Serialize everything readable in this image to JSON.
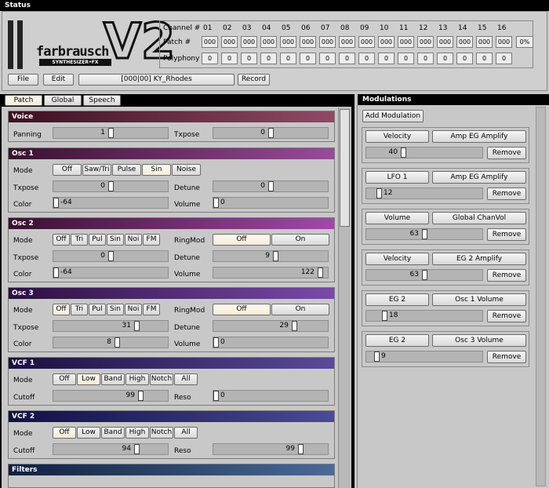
{
  "status": {
    "title": "Status",
    "file": "File",
    "edit": "Edit",
    "patch_name": "[000|00] KY_Rhodes",
    "record": "Record",
    "logo_text": "farbrausch",
    "logo_sub": "SYNTHESIZER•FX",
    "logo_big": "V2",
    "channel_label": "Channel #",
    "patch_label": "Patch #",
    "poly_label": "Polyphony",
    "channels": [
      "01",
      "02",
      "03",
      "04",
      "05",
      "06",
      "07",
      "08",
      "09",
      "10",
      "11",
      "12",
      "13",
      "14",
      "15",
      "16"
    ],
    "patches": [
      "000",
      "000",
      "000",
      "000",
      "000",
      "000",
      "000",
      "000",
      "000",
      "000",
      "000",
      "000",
      "000",
      "000",
      "000",
      "000"
    ],
    "polyphony": [
      "0",
      "0",
      "0",
      "0",
      "0",
      "0",
      "0",
      "0",
      "0",
      "0",
      "0",
      "0",
      "0",
      "0",
      "0",
      "0"
    ],
    "cpu": "0%"
  },
  "tabs": [
    "Patch",
    "Global",
    "Speech"
  ],
  "modulations": {
    "title": "Modulations",
    "add": "Add Modulation",
    "remove": "Remove",
    "items": [
      {
        "source": "Velocity",
        "target": "Amp EG Amplify",
        "amount": "40",
        "level": 0.31
      },
      {
        "source": "LFO 1",
        "target": "Amp EG Amplify",
        "amount": "12",
        "level": 0.09
      },
      {
        "source": "Volume",
        "target": "Global ChanVol",
        "amount": "63",
        "level": 0.5
      },
      {
        "source": "Velocity",
        "target": "EG 2 Amplify",
        "amount": "63",
        "level": 0.5
      },
      {
        "source": "EG 2",
        "target": "Osc 1 Volume",
        "amount": "18",
        "level": 0.14
      },
      {
        "source": "EG 2",
        "target": "Osc 3 Volume",
        "amount": "9",
        "level": 0.07
      }
    ]
  },
  "voice": {
    "title": "Voice",
    "panning_label": "Panning",
    "panning": "1",
    "txpose_label": "Txpose",
    "txpose": "0"
  },
  "osc1": {
    "title": "Osc 1",
    "mode_label": "Mode",
    "modes": [
      "Off",
      "Saw/Tri",
      "Pulse",
      "Sin",
      "Noise"
    ],
    "txpose_label": "Txpose",
    "txpose": "0",
    "detune_label": "Detune",
    "detune": "0",
    "color_label": "Color",
    "color": "-64",
    "volume_label": "Volume",
    "volume": "0"
  },
  "osc2": {
    "title": "Osc 2",
    "mode_label": "Mode",
    "modes": [
      "Off",
      "Tri",
      "Pul",
      "Sin",
      "Noi",
      "FM"
    ],
    "ringmod_label": "RingMod",
    "ring_off": "Off",
    "ring_on": "On",
    "txpose_label": "Txpose",
    "txpose": "0",
    "detune_label": "Detune",
    "detune": "9",
    "color_label": "Color",
    "color": "-64",
    "volume_label": "Volume",
    "volume": "122"
  },
  "osc3": {
    "title": "Osc 3",
    "mode_label": "Mode",
    "modes": [
      "Off",
      "Tri",
      "Pul",
      "Sin",
      "Noi",
      "FM"
    ],
    "ringmod_label": "RingMod",
    "ring_off": "Off",
    "ring_on": "On",
    "txpose_label": "Txpose",
    "txpose": "31",
    "detune_label": "Detune",
    "detune": "29",
    "color_label": "Color",
    "color": "8",
    "volume_label": "Volume",
    "volume": "0"
  },
  "vcf1": {
    "title": "VCF 1",
    "mode_label": "Mode",
    "modes": [
      "Off",
      "Low",
      "Band",
      "High",
      "Notch",
      "All"
    ],
    "cutoff_label": "Cutoff",
    "cutoff": "99",
    "reso_label": "Reso",
    "reso": "0"
  },
  "vcf2": {
    "title": "VCF 2",
    "mode_label": "Mode",
    "modes": [
      "Off",
      "Low",
      "Band",
      "High",
      "Notch",
      "All"
    ],
    "cutoff_label": "Cutoff",
    "cutoff": "94",
    "reso_label": "Reso",
    "reso": "99"
  },
  "filters": {
    "title": "Filters"
  }
}
